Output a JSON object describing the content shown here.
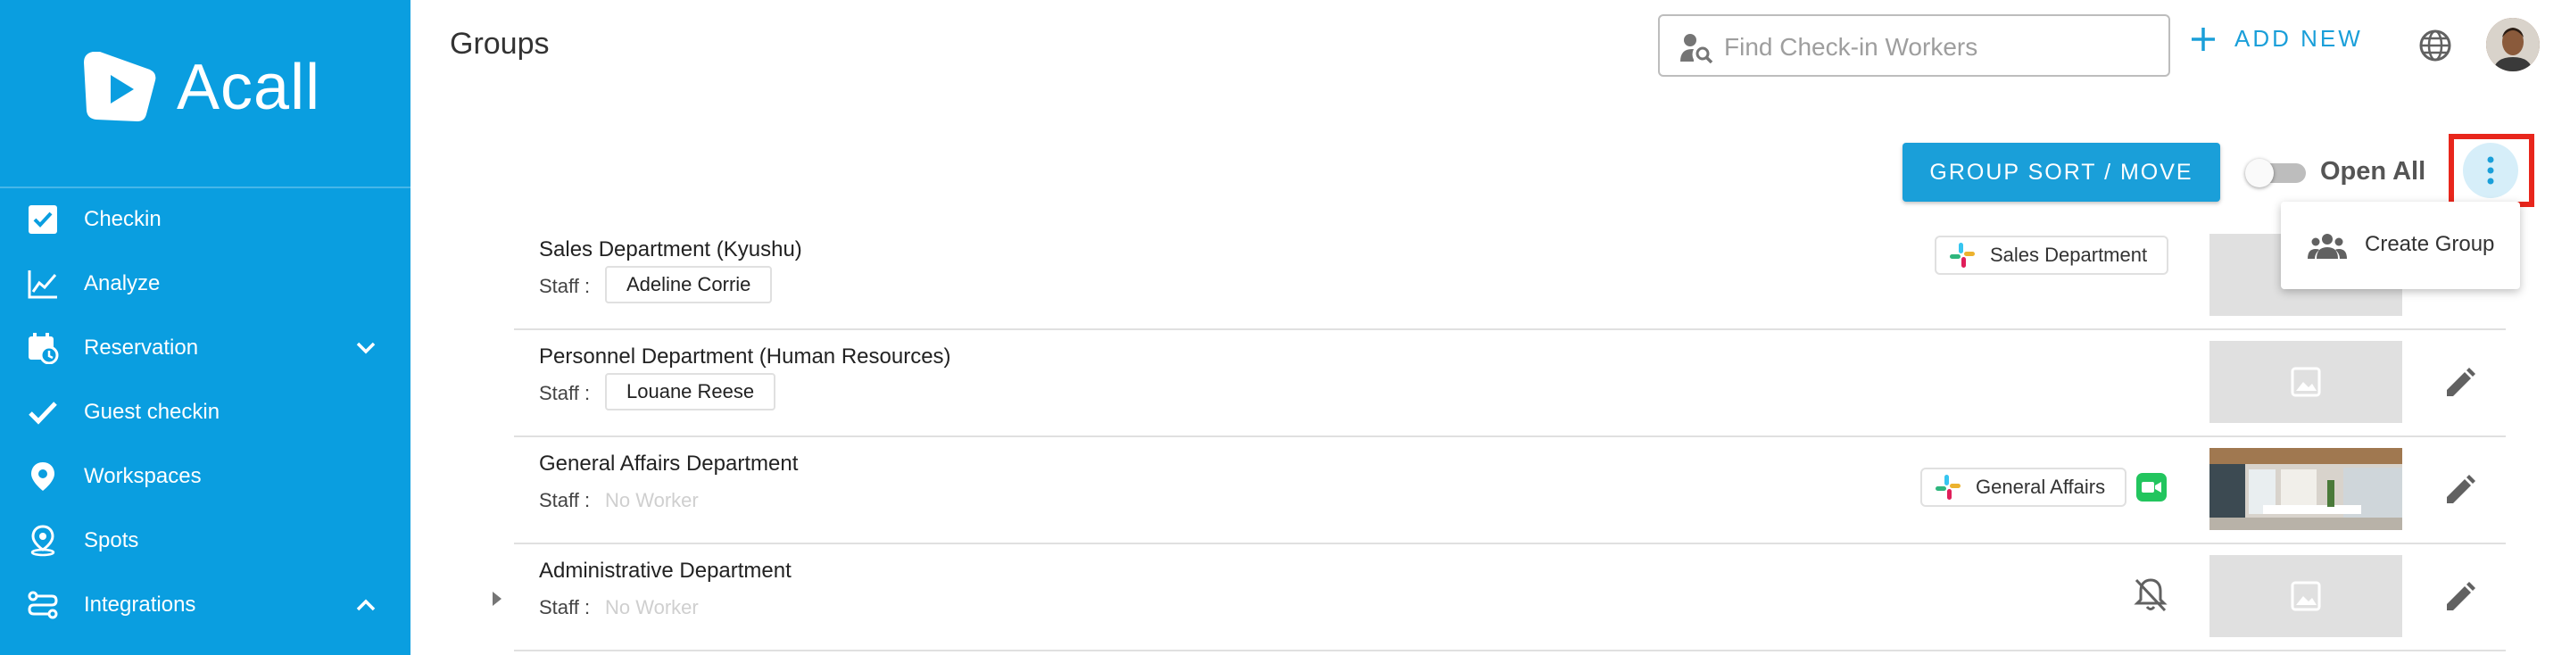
{
  "app": {
    "name": "Acall"
  },
  "header": {
    "title": "Groups",
    "search_placeholder": "Find Check-in Workers",
    "search_value": "",
    "add_new_label": "ADD NEW"
  },
  "sidebar": {
    "items": [
      {
        "label": "Checkin",
        "icon": "checkbox-icon"
      },
      {
        "label": "Analyze",
        "icon": "chart-line-icon"
      },
      {
        "label": "Reservation",
        "icon": "calendar-clock-icon",
        "chevron": "down"
      },
      {
        "label": "Guest checkin",
        "icon": "checkmark-icon"
      },
      {
        "label": "Workspaces",
        "icon": "location-pin-icon"
      },
      {
        "label": "Spots",
        "icon": "spot-pin-icon"
      },
      {
        "label": "Integrations",
        "icon": "integrations-icon",
        "chevron": "up"
      }
    ]
  },
  "toolbar": {
    "sort_move_label": "GROUP SORT / MOVE",
    "open_all_label": "Open All",
    "open_all_on": false
  },
  "menu": {
    "create_group_label": "Create Group"
  },
  "groups": [
    {
      "name": "Sales Department (Kyushu)",
      "staff_label": "Staff :",
      "staff": "Adeline Corrie",
      "slack": "Sales Department"
    },
    {
      "name": "Personnel Department (Human Resources)",
      "staff_label": "Staff :",
      "staff": "Louane Reese"
    },
    {
      "name": "General Affairs Department",
      "staff_label": "Staff :",
      "staff_empty": "No Worker",
      "slack": "General Affairs"
    },
    {
      "name": "Administrative Department",
      "staff_label": "Staff :",
      "staff_empty": "No Worker"
    }
  ],
  "colors": {
    "sidebar_bg": "#0a9ee0",
    "accent": "#1a9fd9",
    "highlight_border": "#e8261c",
    "facetime_green": "#22c55e"
  }
}
